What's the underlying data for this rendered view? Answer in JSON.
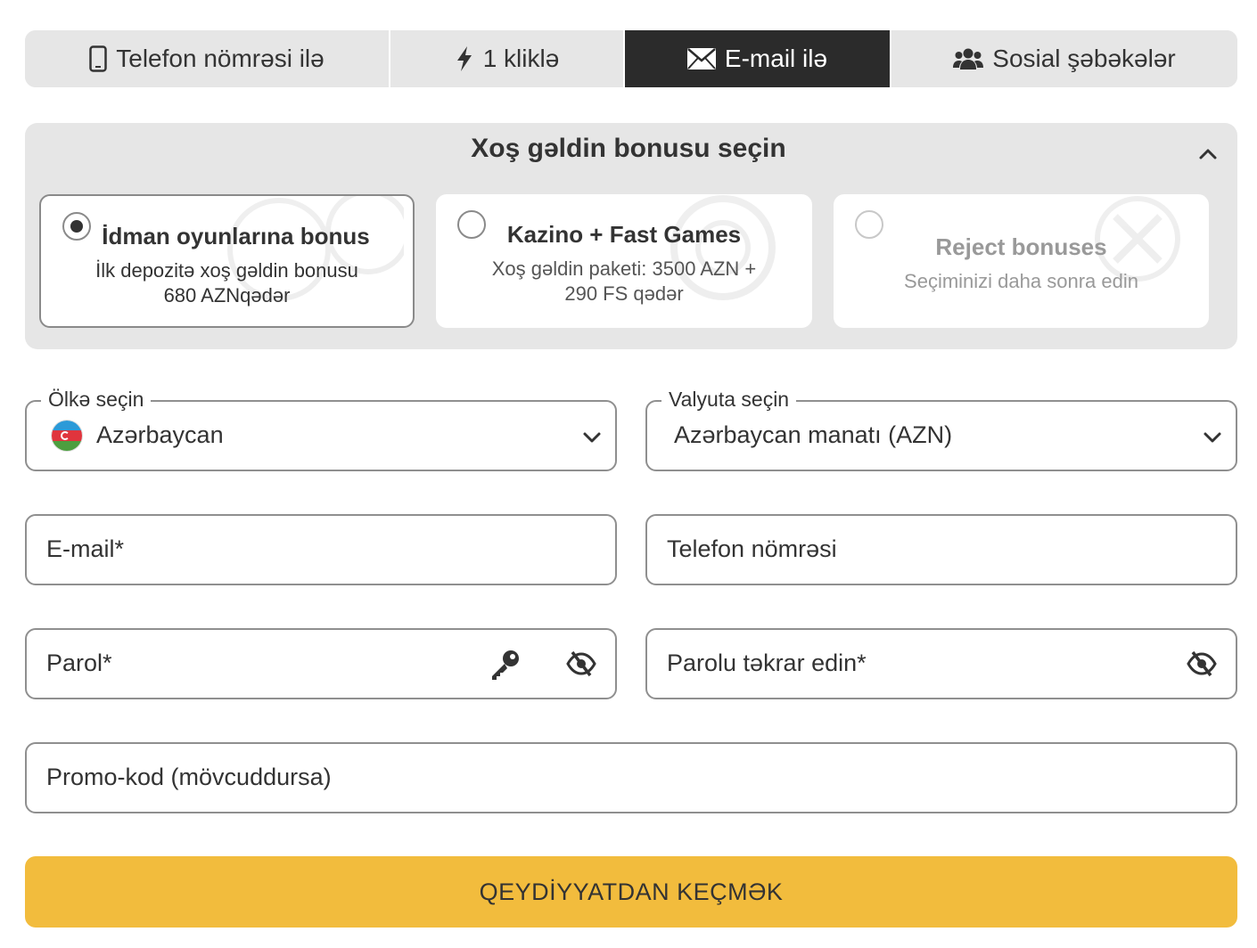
{
  "tabs": [
    {
      "label": "Telefon nömrəsi ilə",
      "icon": "phone-icon",
      "active": false
    },
    {
      "label": "1 kliklə",
      "icon": "lightning-icon",
      "active": false
    },
    {
      "label": "E-mail ilə",
      "icon": "envelope-icon",
      "active": true
    },
    {
      "label": "Sosial şəbəkələr",
      "icon": "users-icon",
      "active": false
    }
  ],
  "bonus": {
    "title": "Xoş gəldin bonusu seçin",
    "options": [
      {
        "title": "İdman oyunlarına bonus",
        "desc_line1": "İlk depozitə xoş gəldin bonusu",
        "desc_line2": "680 AZNqədər",
        "selected": true
      },
      {
        "title": "Kazino + Fast Games",
        "desc_line1": "Xoş gəldin paketi: 3500 AZN +",
        "desc_line2": "290 FS qədər",
        "selected": false
      },
      {
        "title": "Reject bonuses",
        "desc_line1": "Seçiminizi daha sonra edin",
        "selected": false
      }
    ]
  },
  "form": {
    "country": {
      "legend": "Ölkə seçin",
      "value": "Azərbaycan"
    },
    "currency": {
      "legend": "Valyuta seçin",
      "value": "Azərbaycan manatı (AZN)"
    },
    "email": {
      "placeholder": "E-mail*"
    },
    "phone": {
      "placeholder": "Telefon nömrəsi"
    },
    "password": {
      "placeholder": "Parol*"
    },
    "password_repeat": {
      "placeholder": "Parolu təkrar edin*"
    },
    "promo": {
      "placeholder": "Promo-kod (mövcuddursa)"
    },
    "submit_label": "QEYDİYYATDAN KEÇMƏK"
  },
  "colors": {
    "accent": "#f2bc3d",
    "active_tab": "#2b2b2b",
    "panel": "#e6e6e6"
  }
}
